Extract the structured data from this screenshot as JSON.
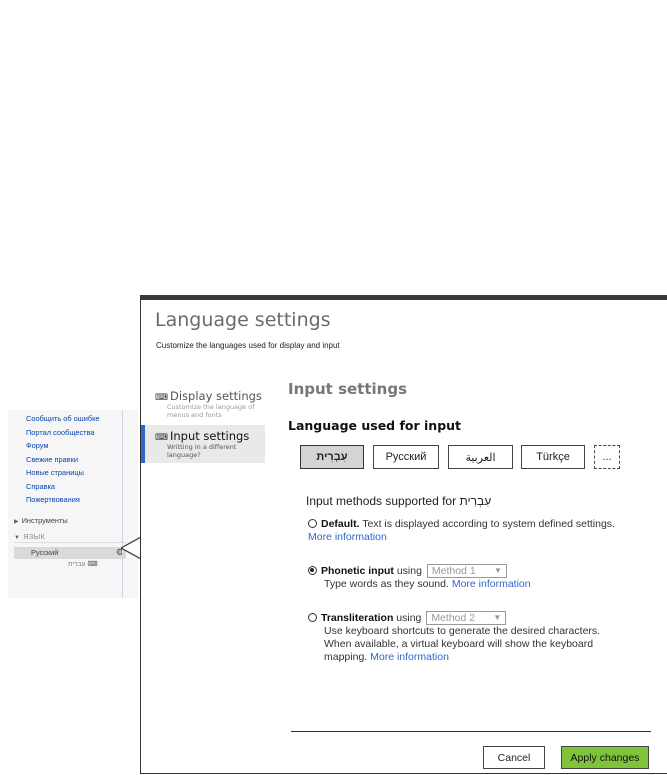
{
  "wiki": {
    "links": [
      "Сообщить об ошибке",
      "Портал сообщества",
      "Форум",
      "Свежие правки",
      "Новые страницы",
      "Справка",
      "Пожертвования"
    ],
    "tools_label": "Инструменты",
    "language_label": "ЯЗЫК",
    "current_language": "Русский",
    "hebrew_label": "עברית"
  },
  "dialog": {
    "title": "Language settings",
    "subtitle": "Customize the languages used for display and input",
    "nav": [
      {
        "title": "Display settings",
        "desc": "Customize the language of menus and fonts"
      },
      {
        "title": "Input settings",
        "desc": "Writting in a different language?"
      }
    ],
    "section_title": "Input settings",
    "language_title": "Language used for input",
    "languages": [
      "עִבְרִית",
      "Русский",
      "العربية",
      "Türkçe",
      "..."
    ],
    "methods_title": "Input methods supported for עִבְרִית",
    "options": {
      "default": {
        "label": "Default.",
        "text": "Text is displayed according to system defined settings.",
        "link": "More information"
      },
      "phonetic": {
        "label": "Phonetic input",
        "using": "using",
        "select": "Method 1",
        "text": "Type words as they sound.",
        "link": "More information"
      },
      "translit": {
        "label": "Transliteration",
        "using": "using",
        "select": "Method 2",
        "text": "Use keyboard shortcuts to generate the desired characters. When available, a virtual keyboard will show the keyboard mapping.",
        "link": "More information"
      }
    },
    "cancel_label": "Cancel",
    "apply_label": "Apply changes"
  },
  "colors": {
    "accent": "#3366cc",
    "apply": "#7ec33a",
    "link": "#0645ad"
  },
  "icons": {
    "display": "keyboard-icon",
    "input": "keyboard-icon",
    "settings": "gear-icon",
    "dropdown": "triangle-down-icon"
  }
}
